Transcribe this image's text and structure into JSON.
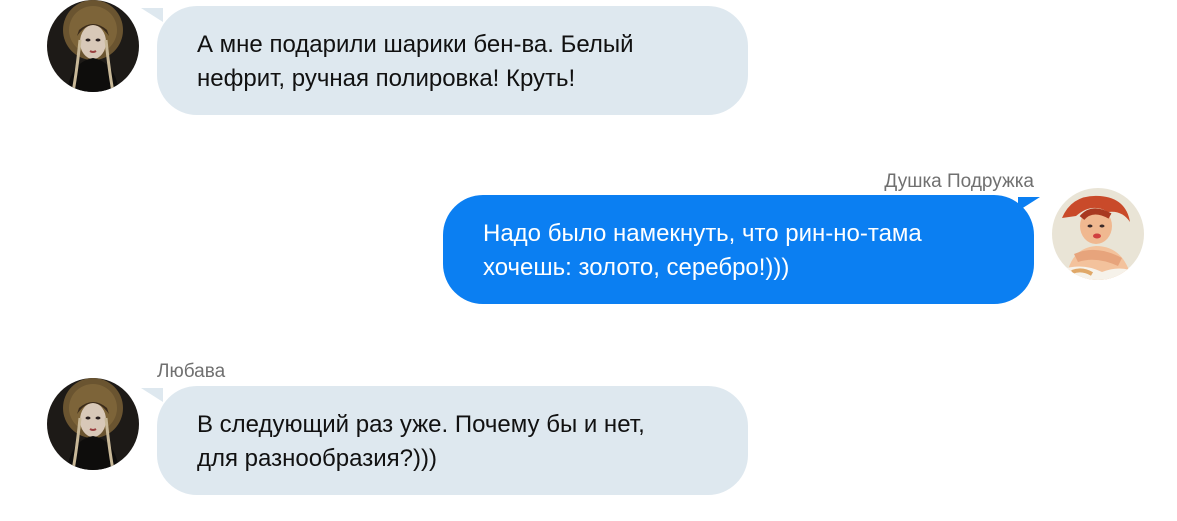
{
  "colors": {
    "incoming_bubble": "#dee8ef",
    "outgoing_bubble": "#0b7ff2",
    "sender_name": "#707070"
  },
  "messages": [
    {
      "direction": "incoming",
      "sender": "",
      "avatar": "lyubava-portrait-avatar",
      "lines": [
        "А мне подарили шарики бен-ва. Белый",
        "нефрит, ручная полировка! Круть!"
      ]
    },
    {
      "direction": "outgoing",
      "sender": "Душка Подружка",
      "avatar": "pinup-redhead-avatar",
      "lines": [
        "Надо было намекнуть, что рин-но-тама",
        "хочешь: золото, серебро!)))"
      ]
    },
    {
      "direction": "incoming",
      "sender": "Любава",
      "avatar": "lyubava-portrait-avatar",
      "lines": [
        "В следующий раз уже. Почему бы и нет,",
        "для разнообразия?)))"
      ]
    }
  ]
}
